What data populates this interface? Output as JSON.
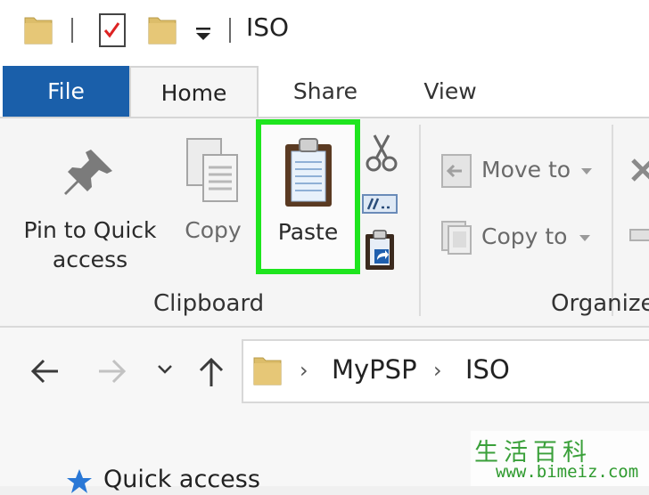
{
  "window": {
    "title": "ISO"
  },
  "tabs": [
    {
      "label": "File"
    },
    {
      "label": "Home"
    },
    {
      "label": "Share"
    },
    {
      "label": "View"
    }
  ],
  "clipboard": {
    "pin_label": "Pin to Quick access",
    "copy_label": "Copy",
    "paste_label": "Paste",
    "group_label": "Clipboard"
  },
  "organize": {
    "move_to_label": "Move to",
    "copy_to_label": "Copy to",
    "group_label": "Organize"
  },
  "breadcrumb": {
    "items": [
      "MyPSP",
      "ISO"
    ]
  },
  "nav_pane": {
    "quick_access_label": "Quick access"
  },
  "watermark": {
    "glyphs": "生活百科",
    "url": "www.bimeiz.com"
  },
  "colors": {
    "file_tab": "#1a5faa",
    "highlight": "#1ee51e",
    "folder": "#dcbd6a",
    "ribbon": "#f5f5f5"
  },
  "icons": [
    "folder-icon",
    "properties-icon",
    "new-folder-icon",
    "customize-dropdown-icon",
    "pin-icon",
    "copy-icon",
    "paste-icon",
    "cut-icon",
    "copy-path-icon",
    "paste-shortcut-icon",
    "move-to-icon",
    "copy-to-icon",
    "delete-icon",
    "rename-icon",
    "back-arrow-icon",
    "forward-arrow-icon",
    "recent-locations-icon",
    "up-arrow-icon",
    "star-icon"
  ]
}
